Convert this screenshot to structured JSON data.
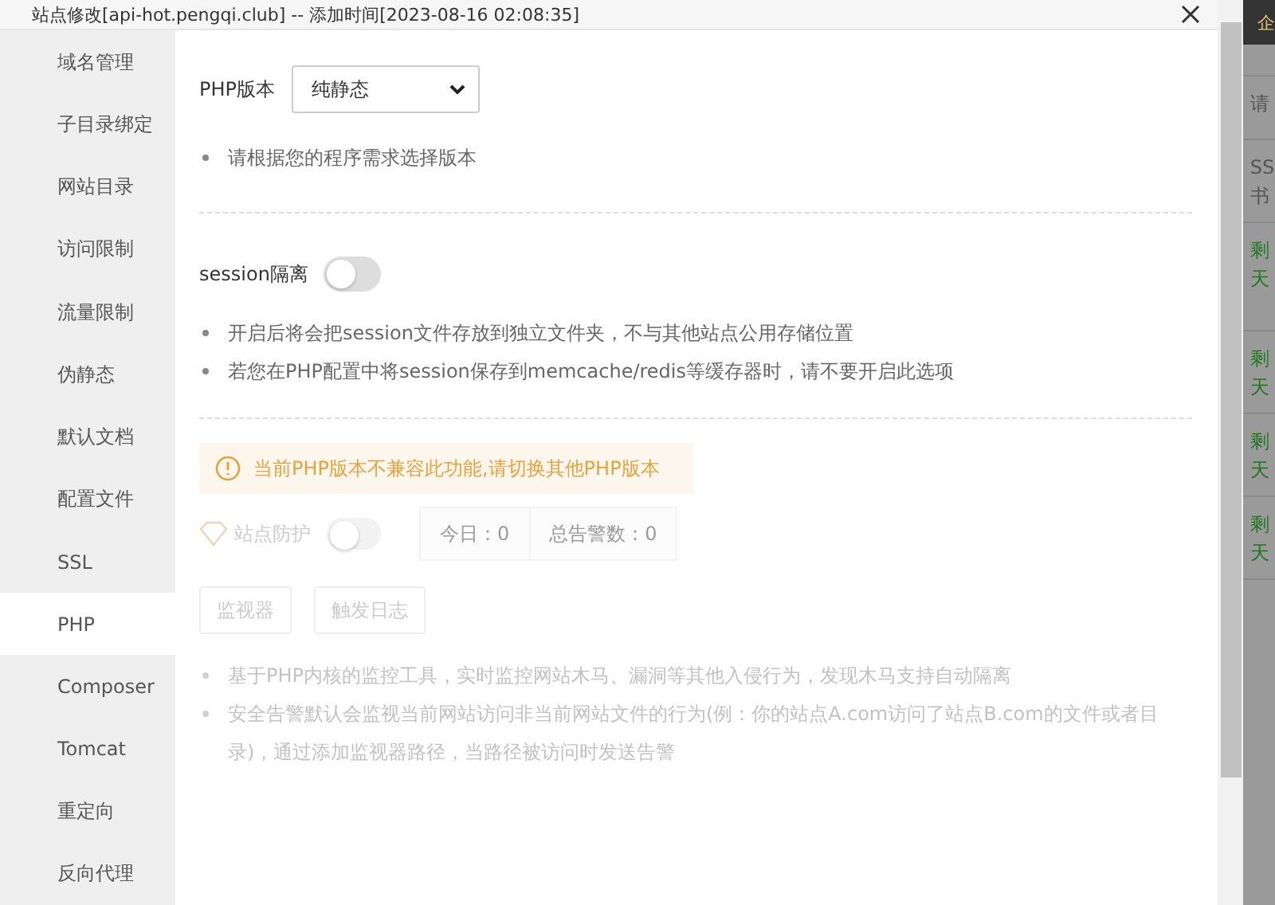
{
  "window": {
    "title": "站点修改[api-hot.pengqi.club] -- 添加时间[2023-08-16 02:08:35]"
  },
  "sidebar": {
    "items": [
      {
        "label": "域名管理",
        "selected": false
      },
      {
        "label": "子目录绑定",
        "selected": false
      },
      {
        "label": "网站目录",
        "selected": false
      },
      {
        "label": "访问限制",
        "selected": false
      },
      {
        "label": "流量限制",
        "selected": false
      },
      {
        "label": "伪静态",
        "selected": false
      },
      {
        "label": "默认文档",
        "selected": false
      },
      {
        "label": "配置文件",
        "selected": false
      },
      {
        "label": "SSL",
        "selected": false
      },
      {
        "label": "PHP",
        "selected": true
      },
      {
        "label": "Composer",
        "selected": false
      },
      {
        "label": "Tomcat",
        "selected": false
      },
      {
        "label": "重定向",
        "selected": false
      },
      {
        "label": "反向代理",
        "selected": false
      }
    ]
  },
  "php_version": {
    "label": "PHP版本",
    "value": "纯静态",
    "hints": [
      "请根据您的程序需求选择版本"
    ]
  },
  "session": {
    "label": "session隔离",
    "on": false,
    "hints": [
      "开启后将会把session文件存放到独立文件夹，不与其他站点公用存储位置",
      "若您在PHP配置中将session保存到memcache/redis等缓存器时，请不要开启此选项"
    ]
  },
  "warning": "当前PHP版本不兼容此功能,请切换其他PHP版本",
  "protection": {
    "label": "站点防护",
    "on": false,
    "disabled": true,
    "stats": [
      "今日：0",
      "总告警数：0"
    ],
    "buttons": [
      "监视器",
      "触发日志"
    ],
    "hints": [
      "基于PHP内核的监控工具，实时监控网站木马、漏洞等其他入侵行为，发现木马支持自动隔离",
      "安全告警默认会监视当前网站访问非当前网站文件的行为(例：你的站点A.com访问了站点B.com的文件或者目录)，通过添加监视器路径，当路径被访问时发送告警"
    ]
  },
  "background": {
    "badge": "企",
    "cells": [
      {
        "lines": [
          "请"
        ],
        "color": "#555555"
      },
      {
        "lines": [
          "SS",
          "书"
        ],
        "color": "#555555"
      },
      {
        "lines": [
          "剩",
          "天"
        ],
        "color": "#1a7a1a"
      },
      {
        "lines": [
          "剩",
          "天"
        ],
        "color": "#1a7a1a"
      },
      {
        "lines": [
          "剩",
          "天"
        ],
        "color": "#1a7a1a"
      },
      {
        "lines": [
          "剩",
          "天"
        ],
        "color": "#1a7a1a"
      }
    ]
  }
}
